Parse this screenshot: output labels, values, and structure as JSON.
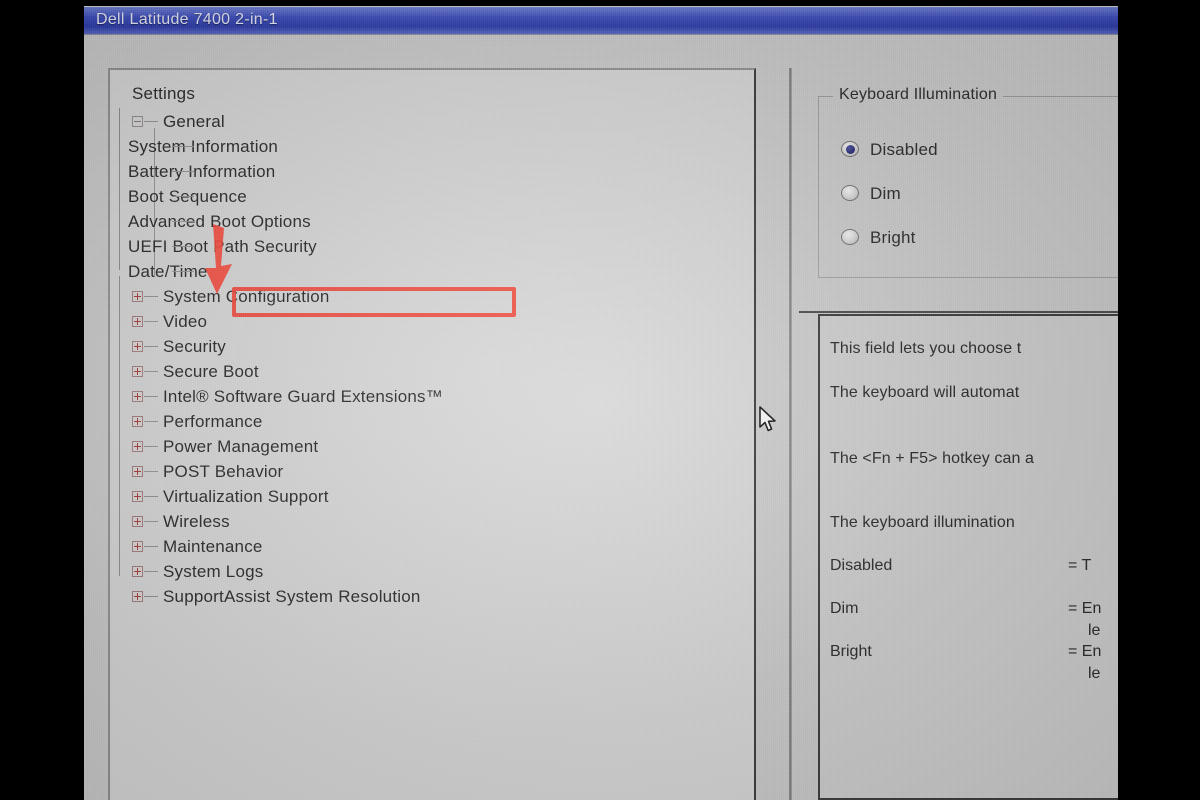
{
  "window": {
    "title": "Dell Latitude 7400 2-in-1"
  },
  "tree": {
    "root_label": "Settings",
    "general": {
      "label": "General",
      "expander": "minus-icon",
      "children": [
        {
          "label": "System Information"
        },
        {
          "label": "Battery Information"
        },
        {
          "label": "Boot Sequence"
        },
        {
          "label": "Advanced Boot Options"
        },
        {
          "label": "UEFI Boot Path Security"
        },
        {
          "label": "Date/Time"
        }
      ]
    },
    "nodes": [
      {
        "label": "System Configuration",
        "expander": "plus-icon",
        "highlighted": true
      },
      {
        "label": "Video",
        "expander": "plus-icon"
      },
      {
        "label": "Security",
        "expander": "plus-icon"
      },
      {
        "label": "Secure Boot",
        "expander": "plus-icon"
      },
      {
        "label": "Intel® Software Guard Extensions™",
        "expander": "plus-icon"
      },
      {
        "label": "Performance",
        "expander": "plus-icon"
      },
      {
        "label": "Power Management",
        "expander": "plus-icon"
      },
      {
        "label": "POST Behavior",
        "expander": "plus-icon"
      },
      {
        "label": "Virtualization Support",
        "expander": "plus-icon"
      },
      {
        "label": "Wireless",
        "expander": "plus-icon"
      },
      {
        "label": "Maintenance",
        "expander": "plus-icon"
      },
      {
        "label": "System Logs",
        "expander": "plus-icon"
      },
      {
        "label": "SupportAssist System Resolution",
        "expander": "plus-icon"
      }
    ]
  },
  "annotation": {
    "arrow": "red-down-arrow-icon",
    "highlight_target": "System Configuration",
    "accent_color": "#ef4237"
  },
  "right_panel": {
    "group_title": "Keyboard Illumination",
    "options": [
      {
        "label": "Disabled",
        "selected": true
      },
      {
        "label": "Dim",
        "selected": false
      },
      {
        "label": "Bright",
        "selected": false
      }
    ],
    "description": {
      "paragraphs": [
        "This field lets you choose t",
        "The keyboard will automat",
        "The <Fn + F5> hotkey can a",
        "The keyboard illumination "
      ],
      "legend": [
        {
          "term": "Disabled",
          "definition": "= T",
          "definition2": ""
        },
        {
          "term": "Dim",
          "definition": "= En",
          "definition2": "le"
        },
        {
          "term": "Bright",
          "definition": "= En",
          "definition2": "le"
        }
      ]
    }
  },
  "cursor": {
    "icon": "mouse-pointer-icon"
  }
}
